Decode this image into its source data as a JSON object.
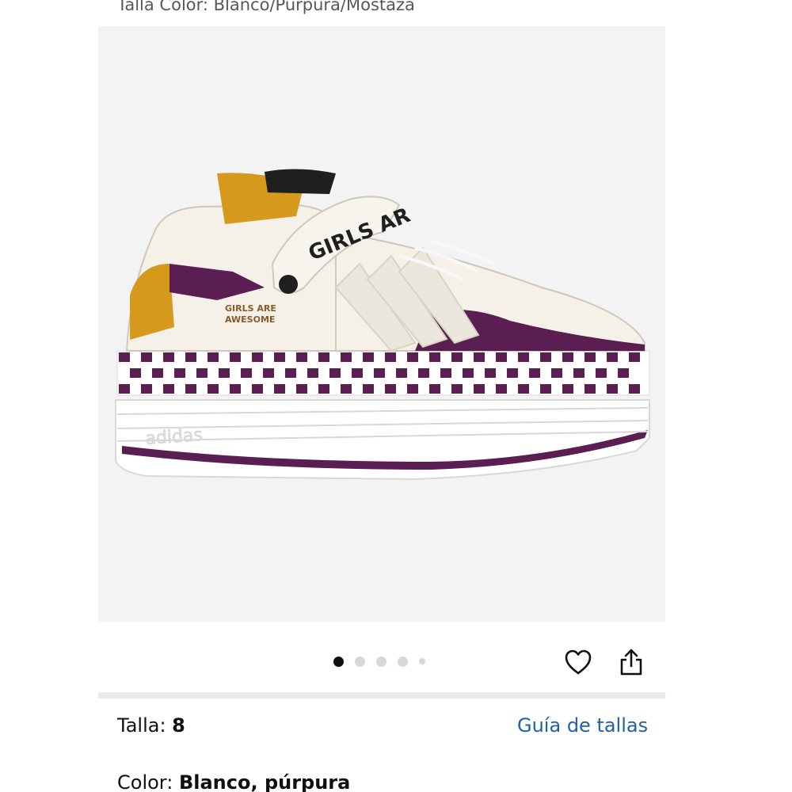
{
  "header": {
    "variant_text": "Talla Color: Blanco/Púrpura/Mostaza"
  },
  "product_image": {
    "brand_mark": "adidas",
    "strap_text": "GIRLS AR",
    "patch_text_1": "GIRLS ARE",
    "patch_text_2": "AWESOME",
    "colors": {
      "background": "#f3f3f3",
      "purple": "#5a1e52",
      "mustard": "#d59a1c",
      "cream": "#f5f1e8",
      "white": "#ffffff"
    }
  },
  "carousel": {
    "dot_count": 5,
    "active_index": 0
  },
  "actions": {
    "wishlist_icon": "heart-icon",
    "share_icon": "share-icon"
  },
  "size": {
    "label": "Talla: ",
    "value": "8",
    "guide_link": "Guía de tallas"
  },
  "color": {
    "label": "Color: ",
    "value": "Blanco, púrpura"
  }
}
